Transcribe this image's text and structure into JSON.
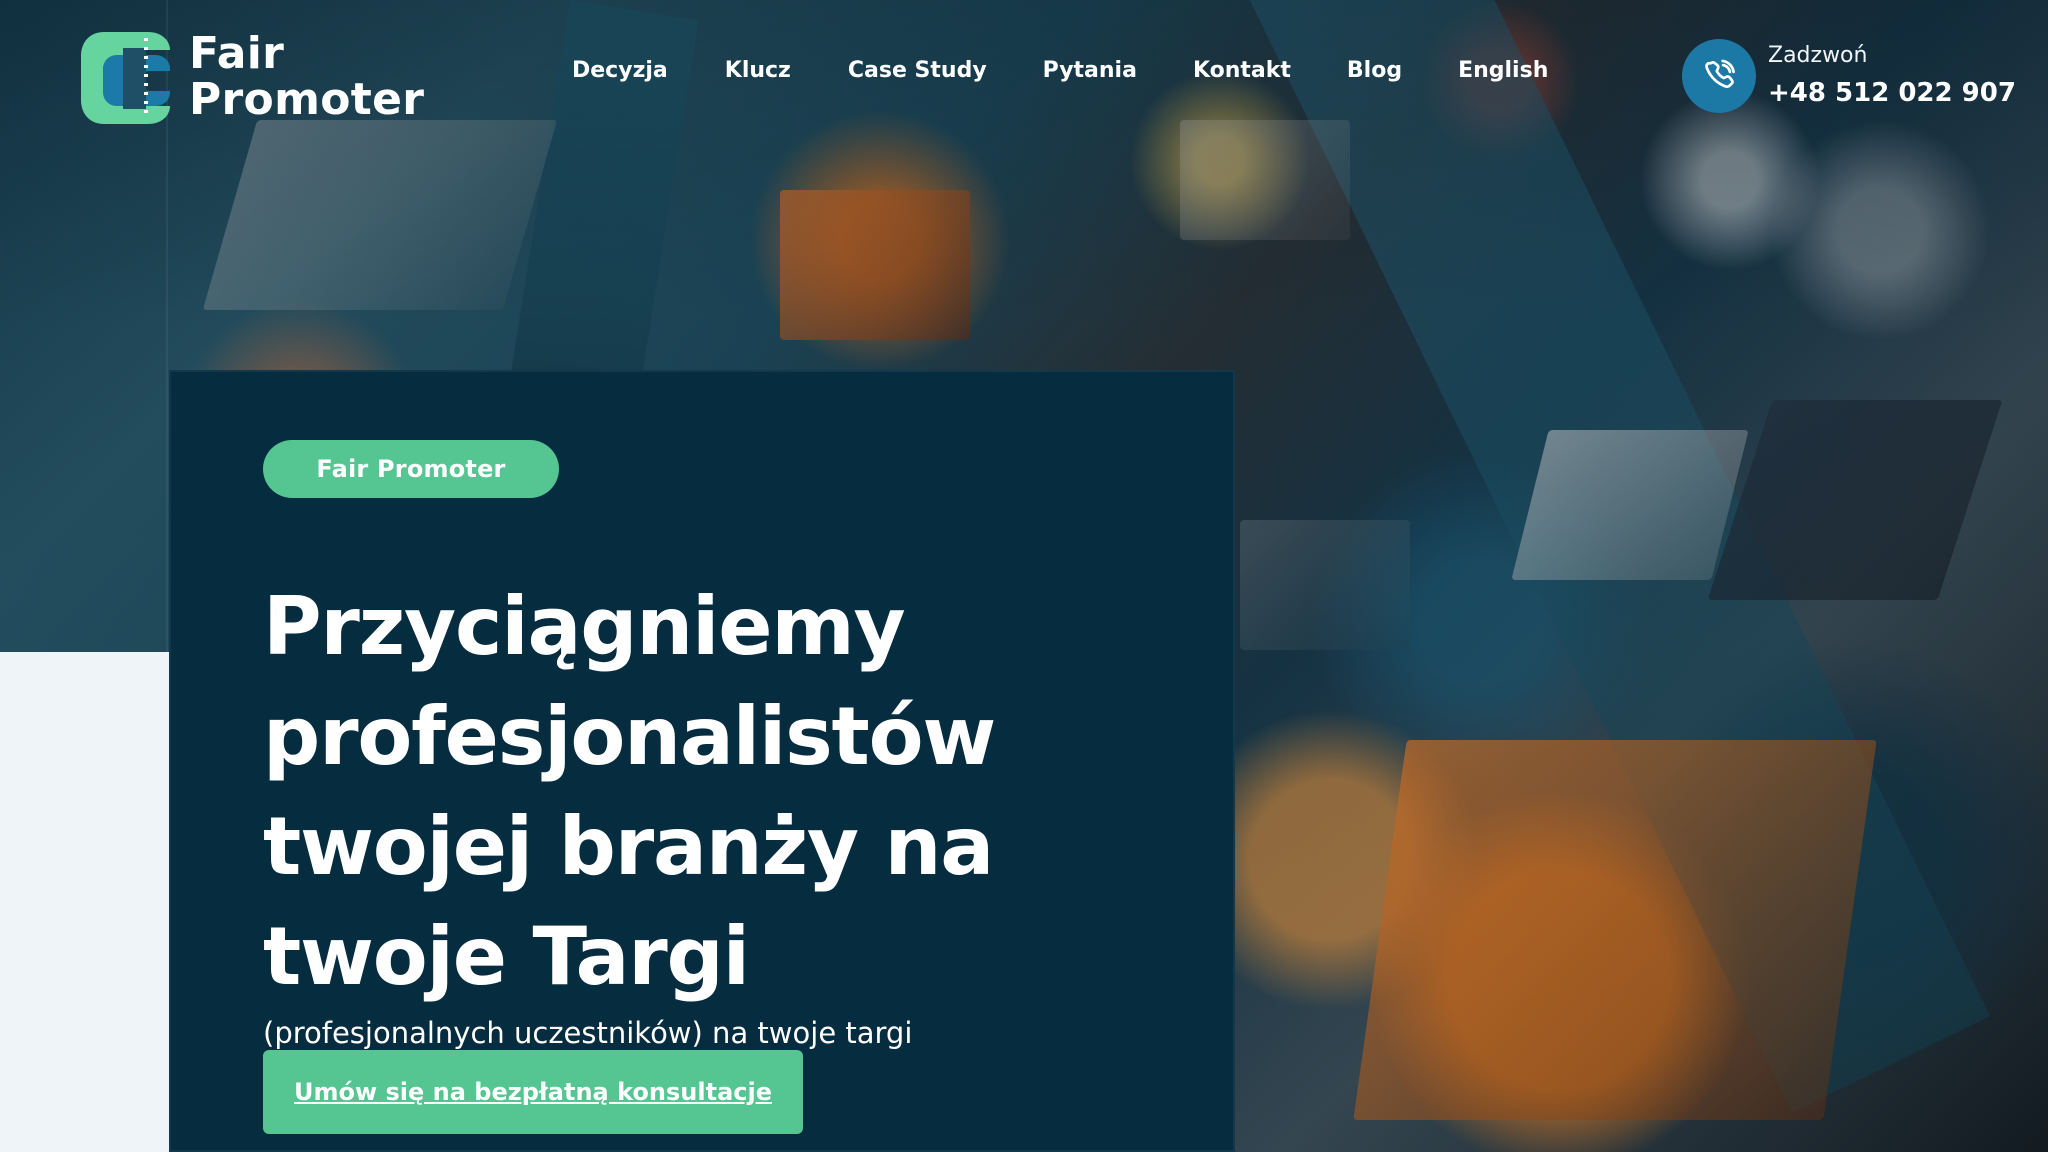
{
  "brand": {
    "logo_line1": "Fair",
    "logo_line2": "Promoter",
    "colors": {
      "primary_dark": "#052c3f",
      "accent_green": "#55c592",
      "accent_blue": "#1c79a6",
      "logo_green": "#66d49f",
      "logo_blue": "#1b7aa8",
      "logo_dark": "#1f4f67"
    }
  },
  "nav": {
    "items": [
      "Decyzja",
      "Klucz",
      "Case Study",
      "Pytania",
      "Kontakt",
      "Blog",
      "English"
    ]
  },
  "call": {
    "label": "Zadzwoń",
    "number": "+48 512 022 907",
    "icon": "phone-icon"
  },
  "hero": {
    "pill": "Fair Promoter",
    "headline_lines": [
      "Przyciągniemy",
      "profesjonalistów",
      "twojej branży na",
      "twoje Targi"
    ],
    "subtext": "(profesjonalnych uczestników) na twoje targi",
    "cta": "Umów się na bezpłatną konsultacje"
  }
}
